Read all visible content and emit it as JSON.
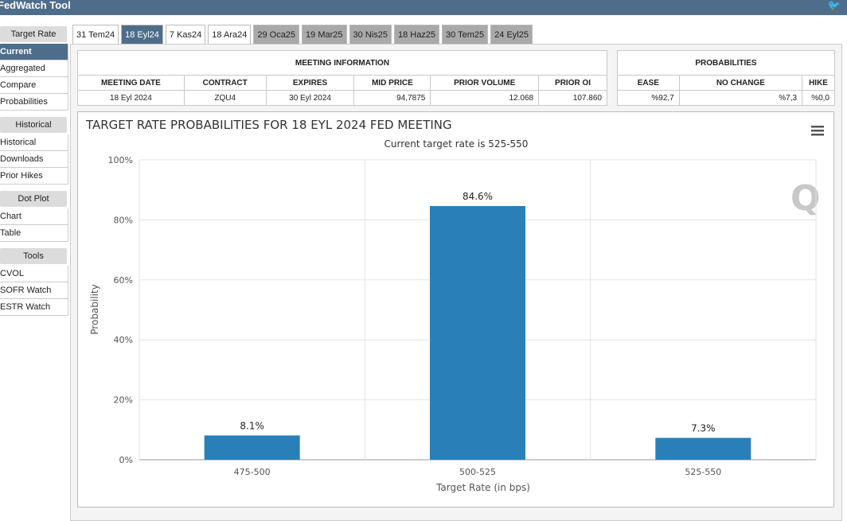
{
  "app": {
    "title": "FedWatch Tool",
    "twitter_icon": "twitter-icon"
  },
  "sidebar": {
    "sections": [
      {
        "header": "Target Rate",
        "items": [
          "Current",
          "Aggregated",
          "Compare",
          "Probabilities"
        ]
      },
      {
        "header": "Historical",
        "items": [
          "Historical",
          "Downloads",
          "Prior Hikes"
        ]
      },
      {
        "header": "Dot Plot",
        "items": [
          "Chart",
          "Table"
        ]
      },
      {
        "header": "Tools",
        "items": [
          "CVOL",
          "SOFR Watch",
          "ESTR Watch"
        ]
      }
    ],
    "active": "Current"
  },
  "tabs": [
    {
      "label": "31 Tem24",
      "state": "normal"
    },
    {
      "label": "18 Eyl24",
      "state": "active"
    },
    {
      "label": "7 Kas24",
      "state": "normal"
    },
    {
      "label": "18 Ara24",
      "state": "normal"
    },
    {
      "label": "29 Oca25",
      "state": "grey"
    },
    {
      "label": "19 Mar25",
      "state": "grey"
    },
    {
      "label": "30 Nis25",
      "state": "grey"
    },
    {
      "label": "18 Haz25",
      "state": "grey"
    },
    {
      "label": "30 Tem25",
      "state": "grey"
    },
    {
      "label": "24 Eyl25",
      "state": "grey"
    }
  ],
  "meeting": {
    "title": "MEETING INFORMATION",
    "headers": [
      "MEETING DATE",
      "CONTRACT",
      "EXPIRES",
      "MID PRICE",
      "PRIOR VOLUME",
      "PRIOR OI"
    ],
    "values": [
      "18 Eyl 2024",
      "ZQU4",
      "30 Eyl 2024",
      "94,7875",
      "12.068",
      "107.860"
    ]
  },
  "probabilities": {
    "title": "PROBABILITIES",
    "headers": [
      "EASE",
      "NO CHANGE",
      "HIKE"
    ],
    "values": [
      "%92,7",
      "%7,3",
      "%0,0"
    ]
  },
  "chart_data": {
    "type": "bar",
    "title": "TARGET RATE PROBABILITIES FOR 18 EYL 2024 FED MEETING",
    "subtitle": "Current target rate is 525-550",
    "xlabel": "Target Rate (in bps)",
    "ylabel": "Probability",
    "categories": [
      "475-500",
      "500-525",
      "525-550"
    ],
    "values": [
      8.1,
      84.6,
      7.3
    ],
    "data_labels": [
      "8.1%",
      "84.6%",
      "7.3%"
    ],
    "ylim": [
      0,
      100
    ],
    "yticks": [
      "0%",
      "20%",
      "40%",
      "60%",
      "80%",
      "100%"
    ],
    "grid": true,
    "color": "#2980b9",
    "menu_icon": "hamburger-menu-icon"
  }
}
